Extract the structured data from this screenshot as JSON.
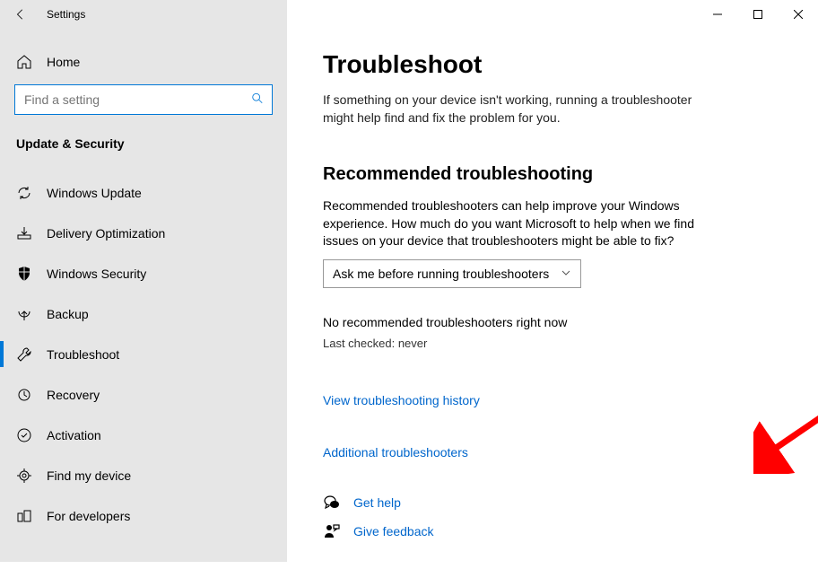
{
  "window": {
    "title": "Settings"
  },
  "sidebar": {
    "home_label": "Home",
    "search_placeholder": "Find a setting",
    "category_title": "Update & Security",
    "items": [
      {
        "label": "Windows Update",
        "icon": "sync-icon"
      },
      {
        "label": "Delivery Optimization",
        "icon": "delivery-icon"
      },
      {
        "label": "Windows Security",
        "icon": "shield-icon"
      },
      {
        "label": "Backup",
        "icon": "backup-icon"
      },
      {
        "label": "Troubleshoot",
        "icon": "wrench-icon",
        "active": true
      },
      {
        "label": "Recovery",
        "icon": "recovery-icon"
      },
      {
        "label": "Activation",
        "icon": "activation-icon"
      },
      {
        "label": "Find my device",
        "icon": "find-device-icon"
      },
      {
        "label": "For developers",
        "icon": "developers-icon"
      }
    ]
  },
  "main": {
    "title": "Troubleshoot",
    "lead": "If something on your device isn't working, running a troubleshooter might help find and fix the problem for you.",
    "section_title": "Recommended troubleshooting",
    "section_para": "Recommended troubleshooters can help improve your Windows experience. How much do you want Microsoft to help when we find issues on your device that troubleshooters might be able to fix?",
    "dropdown_value": "Ask me before running troubleshooters",
    "status_line": "No recommended troubleshooters right now",
    "last_checked": "Last checked: never",
    "link_history": "View troubleshooting history",
    "link_additional": "Additional troubleshooters",
    "footer": {
      "get_help": "Get help",
      "give_feedback": "Give feedback"
    }
  }
}
